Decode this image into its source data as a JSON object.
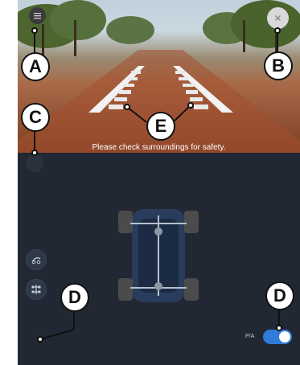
{
  "camera": {
    "safety_message": "Please check surroundings for safety."
  },
  "buttons": {
    "menu_icon": "hamburger-icon",
    "close_icon": "close-icon",
    "close_label": "×"
  },
  "toggle": {
    "label": "P/A",
    "state": "on",
    "color": "#2f7bd8"
  },
  "callouts": {
    "a": "A",
    "b": "B",
    "c": "C",
    "d_left": "D",
    "d_right": "D",
    "e": "E"
  }
}
